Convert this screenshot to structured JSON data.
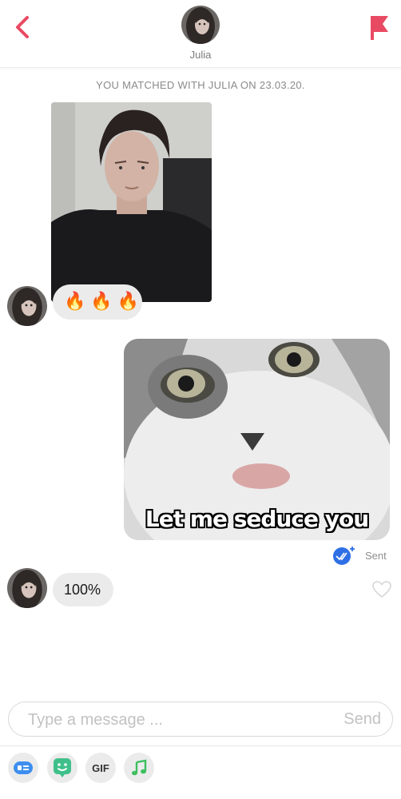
{
  "header": {
    "contact_name": "Julia",
    "back_icon": "chevron-left-icon",
    "flag_icon": "flag-icon",
    "accent_color": "#e94a63"
  },
  "match_notice": "YOU MATCHED WITH JULIA ON 23.03.20.",
  "messages": [
    {
      "direction": "received",
      "type": "photo"
    },
    {
      "direction": "received",
      "type": "text",
      "emojis": [
        "🔥",
        "🔥",
        "🔥"
      ]
    },
    {
      "direction": "sent",
      "type": "gif",
      "caption": "Let me seduce you",
      "status": "Sent",
      "status_icon": "double-check-icon"
    },
    {
      "direction": "received",
      "type": "text",
      "text": "100%",
      "reaction_icon": "heart-outline-icon"
    }
  ],
  "composer": {
    "placeholder": "Type a message ...",
    "send_label": "Send"
  },
  "toolbar": {
    "gif_label": "GIF",
    "icons": [
      "sticker-card-icon",
      "bitmoji-icon",
      "gif-icon",
      "music-note-icon"
    ]
  }
}
